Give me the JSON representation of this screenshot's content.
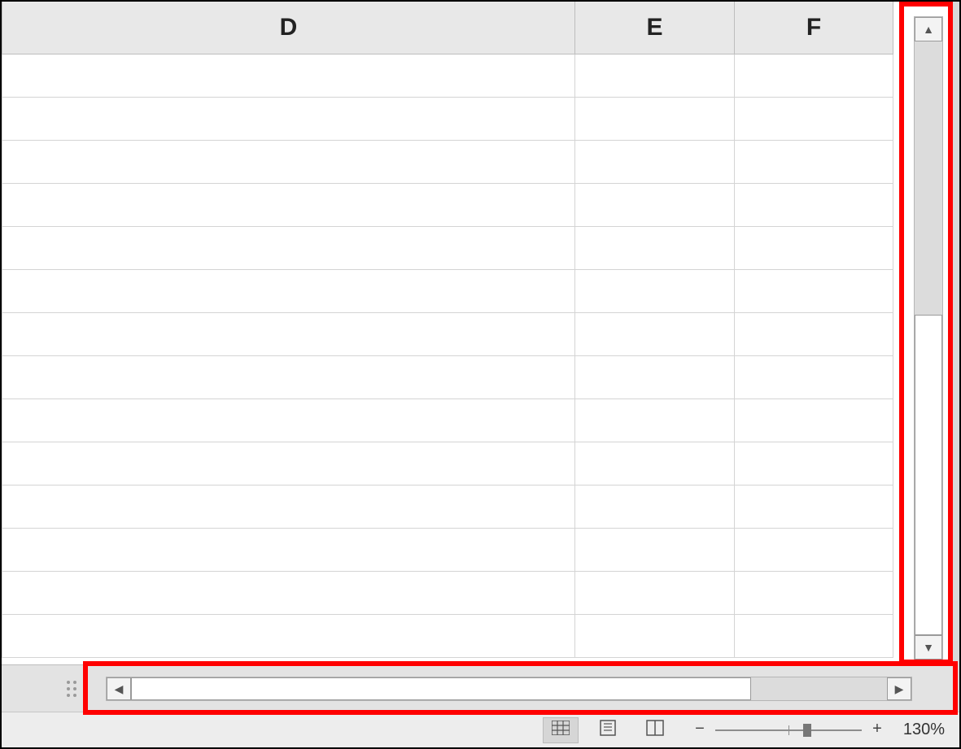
{
  "columns": {
    "d": "D",
    "e": "E",
    "f": "F"
  },
  "row_count": 14,
  "zoom": {
    "label": "130%",
    "percent": 130,
    "slider_pos_pct": 63
  },
  "icons": {
    "scroll_up": "▲",
    "scroll_down": "▼",
    "scroll_left": "◀",
    "scroll_right": "▶",
    "minus": "−",
    "plus": "+"
  },
  "view_buttons": {
    "normal": "normal-view",
    "page_layout": "page-layout-view",
    "page_break": "page-break-preview"
  }
}
